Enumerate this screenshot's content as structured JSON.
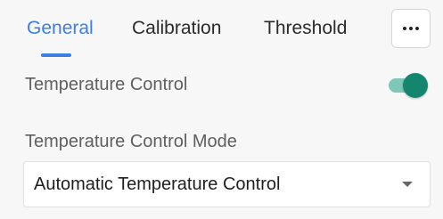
{
  "tabs": [
    {
      "label": "General",
      "active": true
    },
    {
      "label": "Calibration",
      "active": false
    },
    {
      "label": "Threshold",
      "active": false
    }
  ],
  "more_button": {
    "icon": "more-horizontal-icon"
  },
  "temperature_control": {
    "label": "Temperature Control",
    "enabled": true
  },
  "temperature_control_mode": {
    "label": "Temperature Control Mode",
    "selected": "Automatic Temperature Control",
    "icon": "chevron-down-icon"
  },
  "colors": {
    "accent": "#3d7fe0",
    "toggle_on": "#14866d",
    "toggle_track": "#7fc7b6",
    "background": "#f7f7f7"
  }
}
